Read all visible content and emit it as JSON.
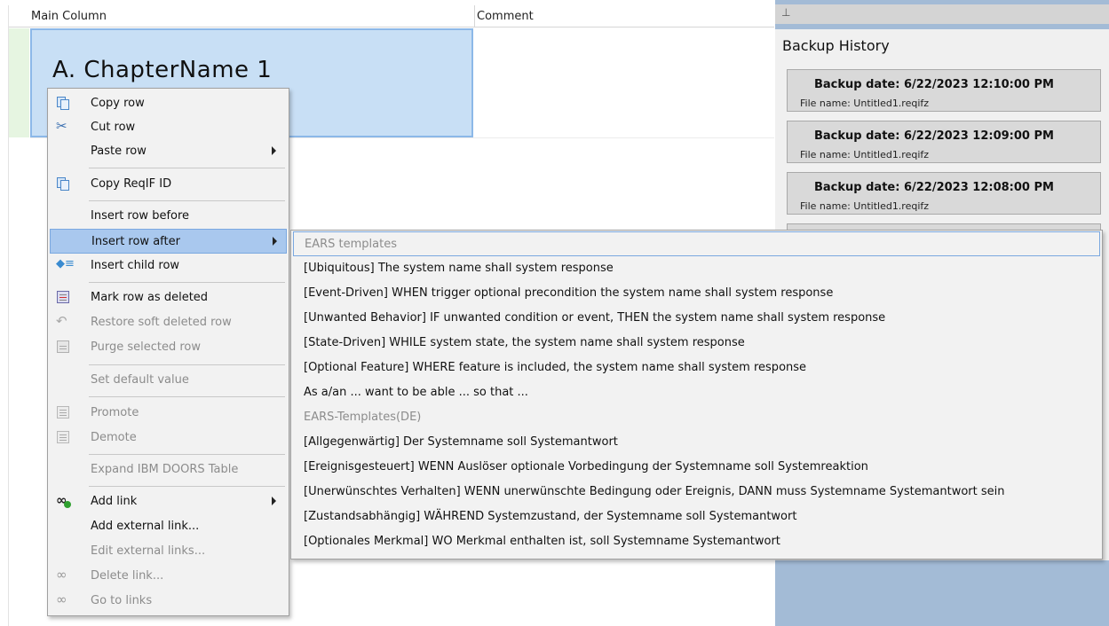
{
  "grid": {
    "columns": [
      "Main Column",
      "Comment"
    ],
    "chapter_title": "A. ChapterName 1"
  },
  "panel": {
    "pin_icon": "pin-icon",
    "title": "Backup History",
    "items": [
      {
        "date": "Backup date: 6/22/2023 12:10:00 PM",
        "file": "File name: Untitled1.reqifz"
      },
      {
        "date": "Backup date: 6/22/2023 12:09:00 PM",
        "file": "File name: Untitled1.reqifz"
      },
      {
        "date": "Backup date: 6/22/2023 12:08:00 PM",
        "file": "File name: Untitled1.reqifz"
      }
    ]
  },
  "context_menu": {
    "items": [
      {
        "label": "Copy row",
        "icon": "copy-icon",
        "enabled": true
      },
      {
        "label": "Cut row",
        "icon": "scissors-icon",
        "enabled": true
      },
      {
        "label": "Paste row",
        "icon": "",
        "enabled": true,
        "submenu": true
      },
      {
        "label": "Copy ReqIF ID",
        "icon": "copy-icon",
        "enabled": true
      },
      {
        "label": "Insert row before",
        "icon": "",
        "enabled": true
      },
      {
        "label": "Insert row after",
        "icon": "",
        "enabled": true,
        "submenu": true,
        "highlighted": true
      },
      {
        "label": "Insert child row",
        "icon": "insert-child-icon",
        "enabled": true
      },
      {
        "label": "Mark row as deleted",
        "icon": "mark-deleted-icon",
        "enabled": true
      },
      {
        "label": "Restore soft deleted row",
        "icon": "restore-icon",
        "enabled": false
      },
      {
        "label": "Purge selected row",
        "icon": "purge-icon",
        "enabled": false
      },
      {
        "label": "Set default value",
        "icon": "",
        "enabled": false
      },
      {
        "label": "Promote",
        "icon": "promote-icon",
        "enabled": false
      },
      {
        "label": "Demote",
        "icon": "demote-icon",
        "enabled": false
      },
      {
        "label": "Expand IBM DOORS Table",
        "icon": "",
        "enabled": false
      },
      {
        "label": "Add link",
        "icon": "add-link-icon",
        "enabled": true,
        "submenu": true
      },
      {
        "label": "Add external link...",
        "icon": "",
        "enabled": true
      },
      {
        "label": "Edit external links...",
        "icon": "",
        "enabled": false
      },
      {
        "label": "Delete link...",
        "icon": "delete-link-icon",
        "enabled": false
      },
      {
        "label": "Go to links",
        "icon": "go-to-links-icon",
        "enabled": false
      }
    ]
  },
  "submenu": {
    "items": [
      {
        "label": "EARS templates",
        "enabled": false
      },
      {
        "label": "[Ubiquitous] The system name shall system response",
        "enabled": true
      },
      {
        "label": "[Event-Driven] WHEN trigger optional precondition the system name shall system response",
        "enabled": true
      },
      {
        "label": "[Unwanted Behavior] IF unwanted condition or event, THEN the system name shall system response",
        "enabled": true
      },
      {
        "label": "[State-Driven] WHILE system state, the system name shall system response",
        "enabled": true
      },
      {
        "label": "[Optional Feature] WHERE feature is included, the system name shall system response",
        "enabled": true
      },
      {
        "label": "As a/an ... want to be able ... so that ...",
        "enabled": true
      },
      {
        "label": "EARS-Templates(DE)",
        "enabled": false
      },
      {
        "label": "[Allgegenwärtig] Der Systemname soll Systemantwort",
        "enabled": true
      },
      {
        "label": "[Ereignisgesteuert] WENN Auslöser optionale Vorbedingung der Systemname soll Systemreaktion",
        "enabled": true
      },
      {
        "label": "[Unerwünschtes Verhalten] WENN unerwünschte Bedingung oder Ereignis, DANN muss Systemname Systemantwort sein",
        "enabled": true
      },
      {
        "label": "[Zustandsabhängig] WÄHREND Systemzustand, der Systemname soll Systemantwort",
        "enabled": true
      },
      {
        "label": "[Optionales Merkmal] WO Merkmal enthalten ist, soll Systemname Systemantwort",
        "enabled": true
      }
    ]
  }
}
